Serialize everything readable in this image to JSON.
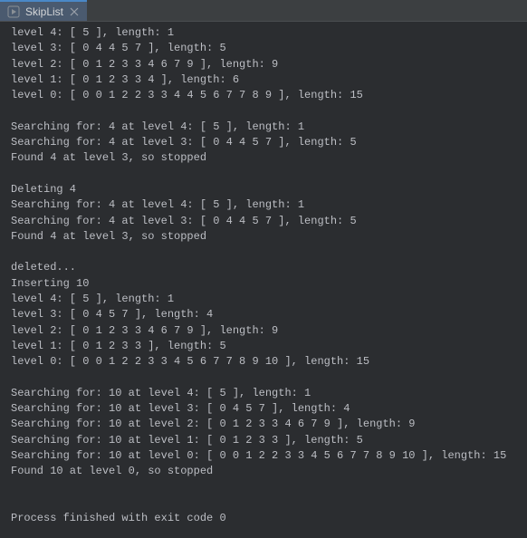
{
  "tab": {
    "title": "SkipList"
  },
  "console": {
    "lines": [
      "level 4: [ 5 ], length: 1",
      "level 3: [ 0 4 4 5 7 ], length: 5",
      "level 2: [ 0 1 2 3 3 4 6 7 9 ], length: 9",
      "level 1: [ 0 1 2 3 3 4 ], length: 6",
      "level 0: [ 0 0 1 2 2 3 3 4 4 5 6 7 7 8 9 ], length: 15",
      "",
      "Searching for: 4 at level 4: [ 5 ], length: 1",
      "Searching for: 4 at level 3: [ 0 4 4 5 7 ], length: 5",
      "Found 4 at level 3, so stopped",
      "",
      "Deleting 4",
      "Searching for: 4 at level 4: [ 5 ], length: 1",
      "Searching for: 4 at level 3: [ 0 4 4 5 7 ], length: 5",
      "Found 4 at level 3, so stopped",
      "",
      "deleted...",
      "Inserting 10",
      "level 4: [ 5 ], length: 1",
      "level 3: [ 0 4 5 7 ], length: 4",
      "level 2: [ 0 1 2 3 3 4 6 7 9 ], length: 9",
      "level 1: [ 0 1 2 3 3 ], length: 5",
      "level 0: [ 0 0 1 2 2 3 3 4 5 6 7 7 8 9 10 ], length: 15",
      "",
      "Searching for: 10 at level 4: [ 5 ], length: 1",
      "Searching for: 10 at level 3: [ 0 4 5 7 ], length: 4",
      "Searching for: 10 at level 2: [ 0 1 2 3 3 4 6 7 9 ], length: 9",
      "Searching for: 10 at level 1: [ 0 1 2 3 3 ], length: 5",
      "Searching for: 10 at level 0: [ 0 0 1 2 2 3 3 4 5 6 7 7 8 9 10 ], length: 15",
      "Found 10 at level 0, so stopped",
      "",
      "",
      "Process finished with exit code 0"
    ]
  }
}
